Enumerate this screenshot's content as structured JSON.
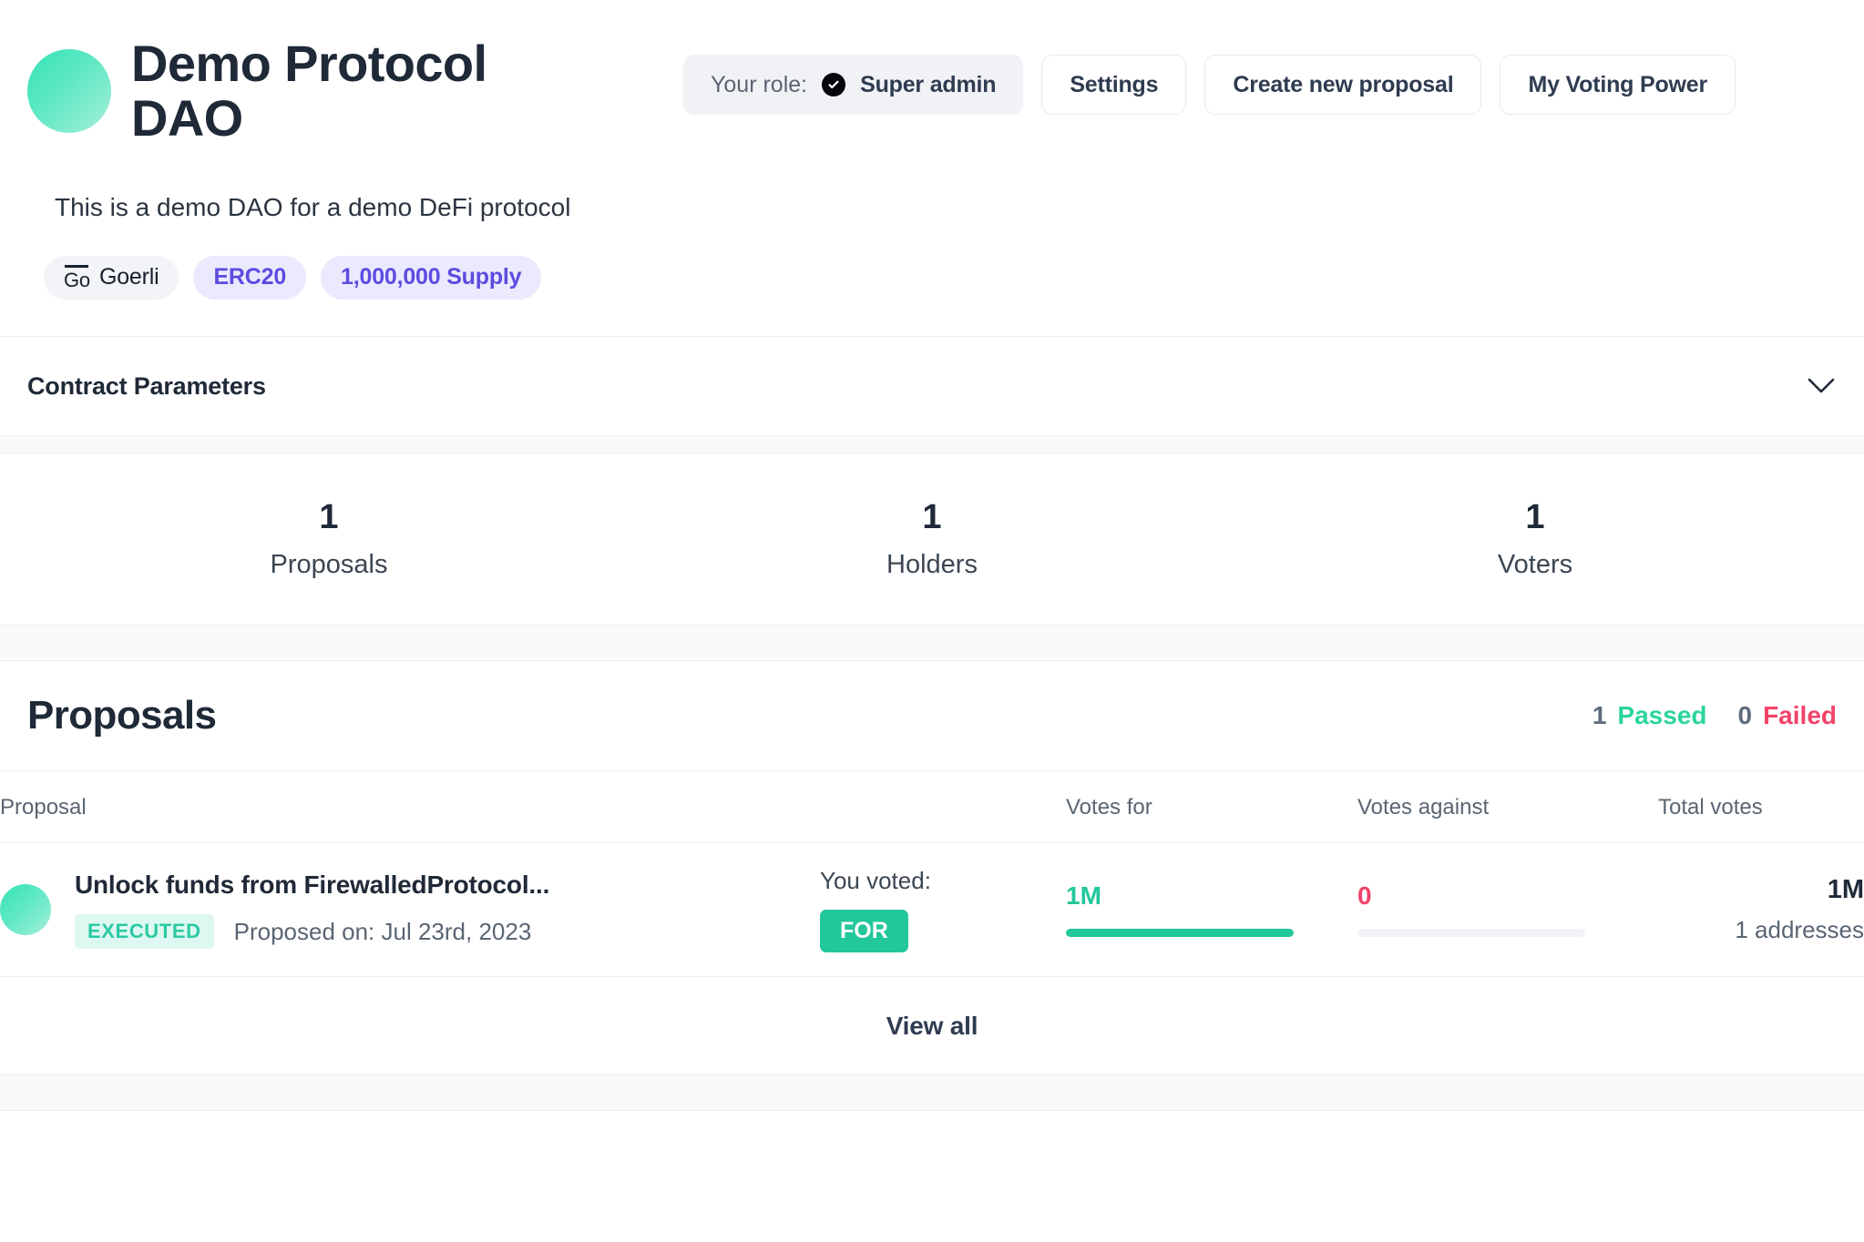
{
  "header": {
    "dao_name": "Demo Protocol DAO",
    "description": "This is a demo DAO for a demo DeFi protocol",
    "role_label": "Your role:",
    "role_value": "Super admin",
    "role_icon": "check-circle-icon",
    "buttons": [
      {
        "label": "Settings",
        "name": "settings-button"
      },
      {
        "label": "Create new proposal",
        "name": "create-new-proposal-button"
      },
      {
        "label": "My Voting Power",
        "name": "my-voting-power-button"
      }
    ],
    "chips": [
      {
        "label": "Goerli",
        "mark": "Go",
        "type": "network"
      },
      {
        "label": "ERC20",
        "type": "token"
      },
      {
        "label": "1,000,000 Supply",
        "type": "token"
      }
    ]
  },
  "contract_parameters": {
    "title": "Contract Parameters",
    "chevron_icon": "chevron-down-icon"
  },
  "stats": [
    {
      "value": "1",
      "label": "Proposals"
    },
    {
      "value": "1",
      "label": "Holders"
    },
    {
      "value": "1",
      "label": "Voters"
    }
  ],
  "proposals_section": {
    "title": "Proposals",
    "passed_count": "1",
    "passed_label": "Passed",
    "failed_count": "0",
    "failed_label": "Failed",
    "columns": {
      "proposal": "Proposal",
      "voted": "",
      "votes_for": "Votes for",
      "votes_against": "Votes against",
      "total_votes": "Total votes"
    },
    "rows": [
      {
        "title": "Unlock funds from FirewalledProtocol...",
        "status": "EXECUTED",
        "proposed_on": "Proposed on: Jul 23rd, 2023",
        "voted_label": "You voted:",
        "voted_value": "FOR",
        "votes_for": "1M",
        "votes_for_percent": 100,
        "votes_against": "0",
        "votes_against_percent": 0,
        "total_votes": "1M",
        "addresses": "1 addresses"
      }
    ],
    "view_all_label": "View all"
  },
  "colors": {
    "accent_green": "#22c79b",
    "accent_red": "#f2436a",
    "accent_purple": "#5b4ce0",
    "text_dark": "#1f2937"
  }
}
